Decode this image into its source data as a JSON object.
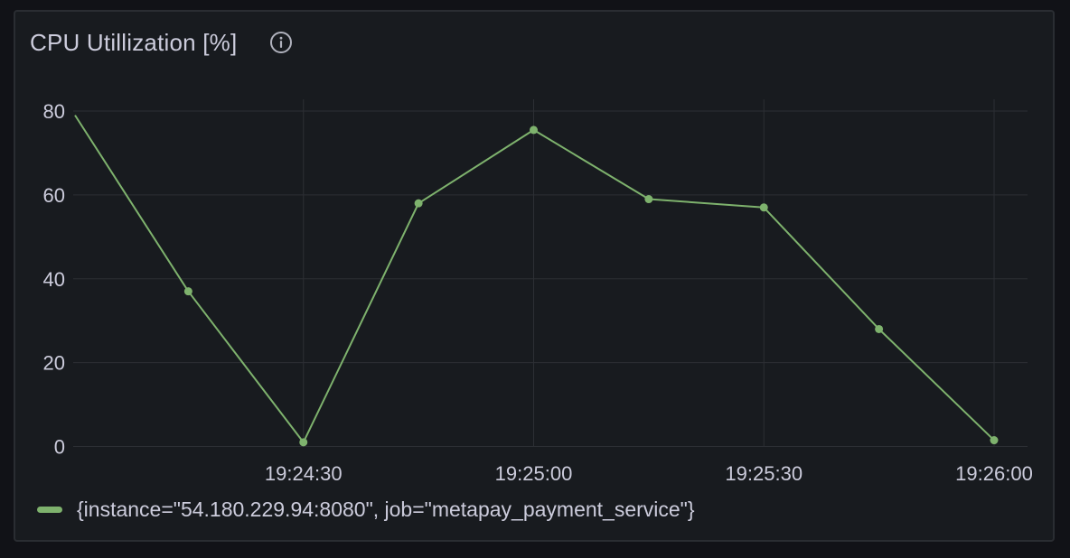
{
  "panel": {
    "title": "CPU Utillization [%]",
    "info_icon": "info-circle-icon"
  },
  "colors": {
    "series": "#7eb26d",
    "grid": "#2c2f34",
    "text": "#ccccdc"
  },
  "chart_data": {
    "type": "line",
    "title": "CPU Utillization [%]",
    "xlabel": "",
    "ylabel": "",
    "ylim": [
      0,
      83
    ],
    "yticks": [
      "0",
      "20",
      "40",
      "60",
      "80"
    ],
    "xlim": [
      "19:24:00",
      "19:26:00"
    ],
    "xticks": [
      "19:24:30",
      "19:25:00",
      "19:25:30",
      "19:26:00"
    ],
    "grid": true,
    "legend_placement": "bottom-left",
    "series": [
      {
        "name": "{instance=\"54.180.229.94:8080\", job=\"metapay_payment_service\"}",
        "x": [
          "19:24:00",
          "19:24:15",
          "19:24:30",
          "19:24:45",
          "19:25:00",
          "19:25:15",
          "19:25:30",
          "19:25:45",
          "19:26:00"
        ],
        "values": [
          79,
          37,
          1,
          58,
          75.5,
          59,
          57,
          28,
          1.5
        ],
        "show_marker": [
          false,
          true,
          true,
          true,
          true,
          true,
          true,
          true,
          true
        ]
      }
    ]
  }
}
